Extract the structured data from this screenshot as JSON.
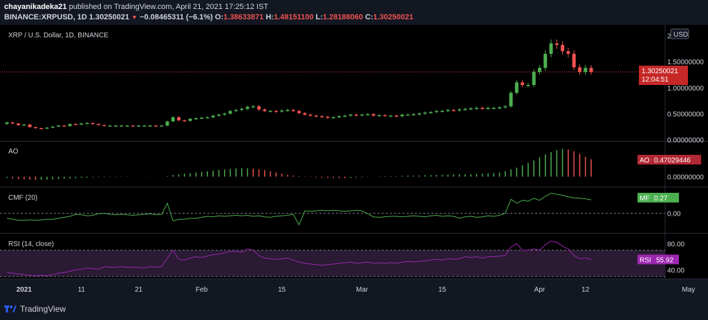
{
  "header": {
    "author": "chayanikadeka21",
    "published_text": "published on TradingView.com, April 21, 2021 17:25:12 IST",
    "symbol": "BINANCE:XRPUSD, 1D",
    "last": "1.30250021",
    "change": "−0.08465311 (−6.1%)",
    "o_label": "O:",
    "o_value": "1.38633871",
    "h_label": "H:",
    "h_value": "1.48151100",
    "l_label": "L:",
    "l_value": "1.28188060",
    "c_label": "C:",
    "c_value": "1.30250021"
  },
  "footer": {
    "brand": "TradingView"
  },
  "colors": {
    "background": "#131722",
    "up": "#4caf50",
    "down": "#ef5350",
    "ao_badge": "#b22833",
    "mf_badge": "#4caf50",
    "rsi_badge": "#9c27b0",
    "cmf_line": "#4caf50",
    "rsi_line": "#9c27b0",
    "rsi_band": "#2a1a33"
  },
  "chart_data": [
    {
      "type": "candlestick",
      "title": "XRP / U.S. Dollar, 1D, BINANCE",
      "currency": "USD",
      "last_price": "1.30250021",
      "countdown": "12:04:51",
      "y_ticks": [
        "2.00",
        "1.50000000",
        "1.00000000",
        "0.50000000",
        "0.00000000"
      ],
      "ylim": [
        0,
        2.1
      ],
      "x_ticks": [
        "2021",
        "11",
        "21",
        "Feb",
        "15",
        "Mar",
        "15",
        "Apr",
        "12",
        "May"
      ],
      "close": [
        0.33,
        0.31,
        0.28,
        0.29,
        0.24,
        0.22,
        0.21,
        0.23,
        0.25,
        0.27,
        0.26,
        0.3,
        0.29,
        0.31,
        0.32,
        0.3,
        0.28,
        0.27,
        0.27,
        0.27,
        0.27,
        0.27,
        0.26,
        0.27,
        0.27,
        0.27,
        0.26,
        0.27,
        0.35,
        0.43,
        0.37,
        0.36,
        0.4,
        0.41,
        0.42,
        0.43,
        0.46,
        0.48,
        0.5,
        0.55,
        0.57,
        0.59,
        0.63,
        0.64,
        0.58,
        0.55,
        0.55,
        0.54,
        0.56,
        0.57,
        0.55,
        0.51,
        0.48,
        0.46,
        0.45,
        0.44,
        0.42,
        0.43,
        0.45,
        0.46,
        0.48,
        0.47,
        0.48,
        0.49,
        0.46,
        0.47,
        0.46,
        0.46,
        0.45,
        0.48,
        0.48,
        0.49,
        0.5,
        0.52,
        0.53,
        0.55,
        0.55,
        0.57,
        0.56,
        0.58,
        0.59,
        0.6,
        0.61,
        0.6,
        0.61,
        0.61,
        0.62,
        0.64,
        0.9,
        1.1,
        1.05,
        1.05,
        1.3,
        1.38,
        1.65,
        1.85,
        1.82,
        1.7,
        1.65,
        1.39,
        1.3,
        1.38,
        1.3
      ],
      "open": [
        0.3,
        0.33,
        0.31,
        0.28,
        0.29,
        0.24,
        0.22,
        0.21,
        0.23,
        0.25,
        0.27,
        0.26,
        0.3,
        0.29,
        0.31,
        0.32,
        0.3,
        0.28,
        0.27,
        0.27,
        0.27,
        0.27,
        0.27,
        0.26,
        0.27,
        0.27,
        0.27,
        0.26,
        0.27,
        0.35,
        0.43,
        0.37,
        0.36,
        0.4,
        0.41,
        0.42,
        0.43,
        0.46,
        0.48,
        0.5,
        0.55,
        0.57,
        0.59,
        0.63,
        0.64,
        0.58,
        0.55,
        0.55,
        0.54,
        0.56,
        0.57,
        0.55,
        0.51,
        0.48,
        0.46,
        0.45,
        0.44,
        0.42,
        0.43,
        0.45,
        0.46,
        0.48,
        0.47,
        0.48,
        0.49,
        0.46,
        0.47,
        0.46,
        0.46,
        0.45,
        0.48,
        0.48,
        0.49,
        0.5,
        0.52,
        0.53,
        0.55,
        0.55,
        0.57,
        0.56,
        0.58,
        0.59,
        0.6,
        0.61,
        0.6,
        0.61,
        0.61,
        0.62,
        0.64,
        0.9,
        1.1,
        1.05,
        1.05,
        1.3,
        1.38,
        1.65,
        1.85,
        1.82,
        1.7,
        1.65,
        1.39,
        1.3,
        1.38
      ]
    },
    {
      "type": "bar",
      "title": "AO",
      "badge_label": "AO",
      "badge_value": "0.47029446",
      "y_ticks": [
        "0.00000000"
      ],
      "ylim": [
        -0.05,
        0.5
      ],
      "values": [
        -0.02,
        -0.03,
        -0.04,
        -0.045,
        -0.05,
        -0.055,
        -0.055,
        -0.05,
        -0.045,
        -0.04,
        -0.035,
        -0.03,
        -0.025,
        -0.02,
        -0.015,
        -0.01,
        -0.008,
        -0.006,
        -0.005,
        -0.005,
        -0.004,
        -0.004,
        -0.003,
        -0.003,
        -0.002,
        -0.002,
        -0.002,
        -0.001,
        0.01,
        0.03,
        0.04,
        0.05,
        0.06,
        0.07,
        0.08,
        0.09,
        0.1,
        0.11,
        0.12,
        0.13,
        0.135,
        0.14,
        0.14,
        0.13,
        0.12,
        0.11,
        0.09,
        0.07,
        0.05,
        0.03,
        0.02,
        0.01,
        0.005,
        -0.005,
        -0.01,
        -0.015,
        -0.02,
        -0.022,
        -0.024,
        -0.025,
        -0.02,
        -0.015,
        -0.01,
        -0.005,
        0.0,
        0.005,
        0.008,
        0.01,
        0.012,
        0.015,
        0.018,
        0.02,
        0.022,
        0.025,
        0.028,
        0.03,
        0.032,
        0.034,
        0.036,
        0.038,
        0.04,
        0.042,
        0.045,
        0.05,
        0.055,
        0.06,
        0.07,
        0.09,
        0.12,
        0.15,
        0.19,
        0.23,
        0.27,
        0.32,
        0.37,
        0.41,
        0.44,
        0.46,
        0.45,
        0.42,
        0.38,
        0.33,
        0.29
      ]
    },
    {
      "type": "line",
      "title": "CMF (20)",
      "badge_label": "MF",
      "badge_value": "0.27",
      "y_ticks": [
        "0.00"
      ],
      "ylim": [
        -0.35,
        0.45
      ],
      "values": [
        -0.1,
        -0.12,
        -0.14,
        -0.14,
        -0.13,
        -0.14,
        -0.13,
        -0.12,
        -0.12,
        -0.1,
        -0.08,
        -0.06,
        -0.02,
        -0.03,
        -0.05,
        -0.04,
        -0.01,
        0.0,
        -0.02,
        -0.03,
        -0.02,
        -0.03,
        -0.04,
        -0.03,
        -0.02,
        -0.01,
        -0.03,
        -0.02,
        0.2,
        -0.15,
        -0.12,
        -0.12,
        -0.1,
        -0.1,
        -0.08,
        -0.06,
        -0.07,
        -0.05,
        -0.06,
        -0.05,
        -0.04,
        -0.05,
        -0.04,
        -0.06,
        -0.05,
        -0.07,
        -0.08,
        -0.06,
        -0.05,
        -0.04,
        -0.02,
        -0.23,
        0.05,
        0.04,
        0.05,
        0.06,
        0.05,
        0.06,
        0.05,
        0.04,
        0.05,
        0.06,
        0.05,
        -0.01,
        -0.07,
        -0.08,
        -0.07,
        -0.06,
        -0.06,
        -0.07,
        -0.06,
        -0.05,
        -0.06,
        -0.07,
        -0.05,
        -0.04,
        -0.06,
        -0.05,
        -0.06,
        -0.1,
        -0.07,
        -0.06,
        -0.08,
        -0.07,
        -0.05,
        -0.06,
        -0.04,
        0.0,
        0.28,
        0.2,
        0.26,
        0.24,
        0.3,
        0.26,
        0.34,
        0.4,
        0.38,
        0.36,
        0.33,
        0.31,
        0.3,
        0.29,
        0.27
      ]
    },
    {
      "type": "line",
      "title": "RSI (14, close)",
      "badge_label": "RSI",
      "badge_value": "55.92",
      "y_ticks": [
        "80.00",
        "40.00"
      ],
      "ylim": [
        28,
        92
      ],
      "bands": [
        70,
        30
      ],
      "values": [
        36,
        35,
        34,
        33,
        32,
        31,
        32,
        31,
        33,
        35,
        36,
        38,
        40,
        41,
        43,
        42,
        41,
        45,
        44,
        44,
        45,
        44,
        44,
        44,
        43,
        45,
        44,
        45,
        58,
        70,
        56,
        55,
        58,
        60,
        59,
        61,
        63,
        64,
        66,
        68,
        68,
        67,
        72,
        70,
        62,
        58,
        57,
        56,
        57,
        58,
        55,
        52,
        50,
        49,
        48,
        47,
        48,
        49,
        50,
        51,
        52,
        50,
        51,
        52,
        50,
        51,
        50,
        51,
        50,
        52,
        53,
        52,
        53,
        54,
        55,
        56,
        55,
        57,
        56,
        57,
        60,
        59,
        60,
        58,
        60,
        60,
        61,
        62,
        75,
        80,
        70,
        70,
        72,
        70,
        78,
        84,
        82,
        76,
        72,
        62,
        57,
        58,
        55.9
      ]
    }
  ]
}
